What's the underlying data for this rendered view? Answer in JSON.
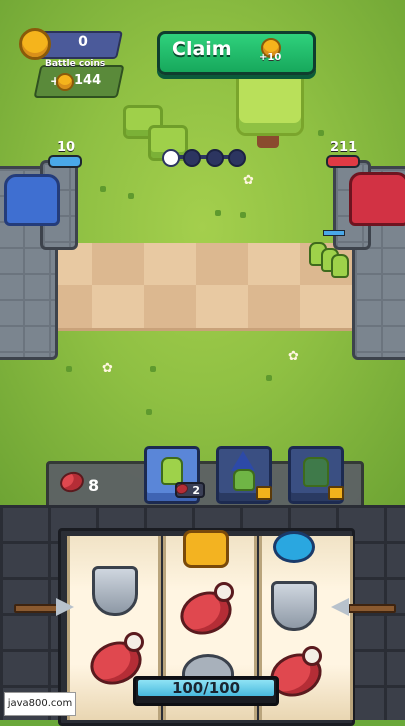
{
  "hud": {
    "coins": "0",
    "battle_coins_title": "Battle coins",
    "battle_coins_plus": "+",
    "battle_coins_value": "144",
    "claim_label": "Claim",
    "claim_reward": "+10"
  },
  "battle": {
    "player_hp": "10",
    "enemy_hp": "211",
    "player_color": "#4aa8e8",
    "enemy_color": "#e03a44",
    "wave_nodes": 4,
    "wave_active_index": 0
  },
  "deck": {
    "meat_count": "8",
    "cards": [
      {
        "name": "goblin",
        "cost": "2",
        "locked": false
      },
      {
        "name": "goblin-wizard",
        "locked": true
      },
      {
        "name": "goblin-brute",
        "locked": true
      }
    ]
  },
  "slot_machine": {
    "energy_text": "100/100",
    "energy_fraction": 1.0,
    "reels": [
      [
        "shield",
        "meat"
      ],
      [
        "gold-coin",
        "meat",
        "stone"
      ],
      [
        "ring",
        "shield",
        "meat"
      ]
    ]
  },
  "watermark": "java800.com",
  "icons": [
    "coin-icon",
    "meat-icon",
    "lock-icon",
    "shield-icon",
    "arrow-icon"
  ]
}
